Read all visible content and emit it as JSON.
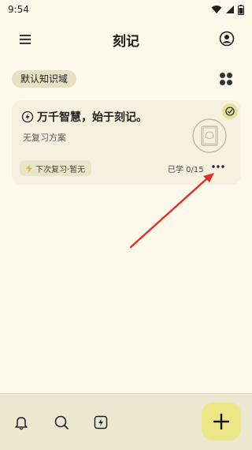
{
  "status_bar": {
    "time": "9:54"
  },
  "header": {
    "title": "刻记"
  },
  "domain": {
    "chip_label": "默认知识域"
  },
  "card": {
    "title": "万千智慧，始于刻记。",
    "subtitle": "无复习方案",
    "next_review": "下次复习·暂无",
    "progress": "已学 0/15"
  },
  "colors": {
    "accent": "#ece786",
    "arrow": "#e0302a"
  },
  "icons": {
    "menu": "menu-icon",
    "account": "account-icon",
    "grid": "grid-icon",
    "bell": "bell-icon",
    "search": "search-icon",
    "flash": "flash-icon",
    "add": "plus-icon"
  }
}
